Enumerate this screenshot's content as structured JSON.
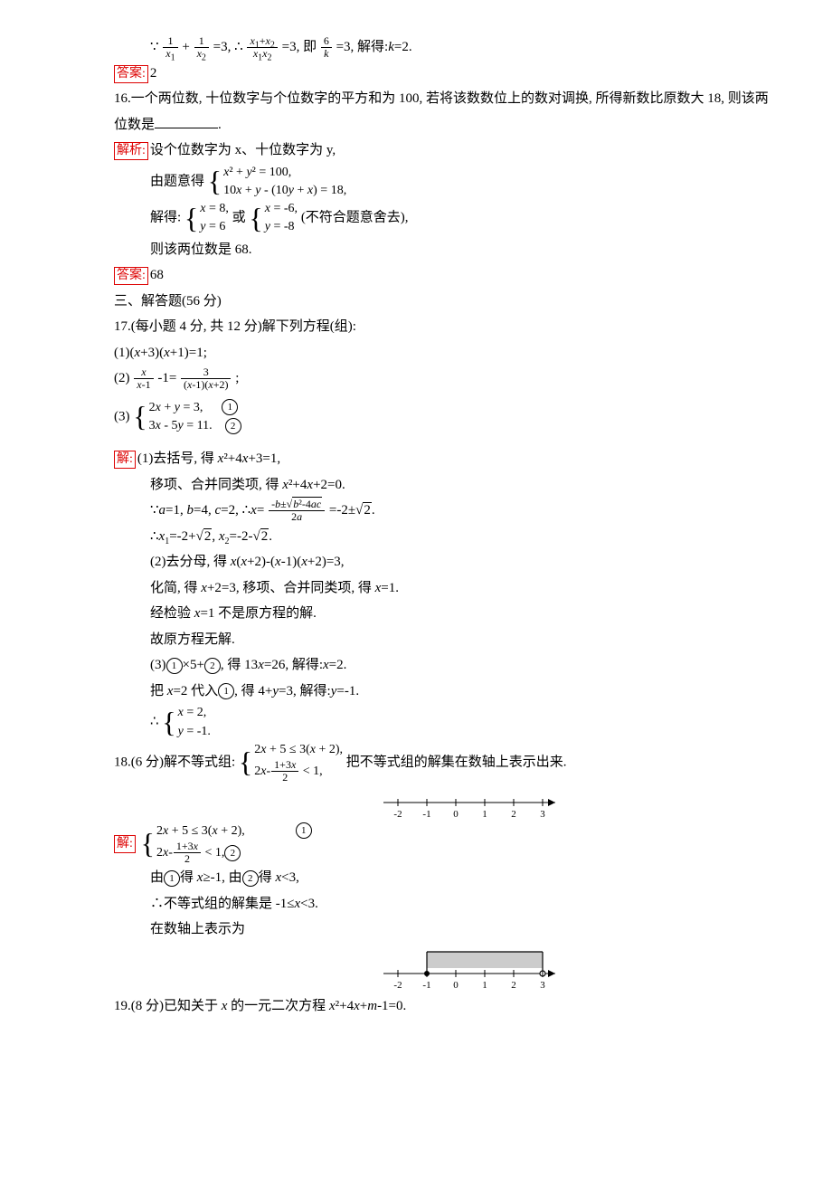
{
  "q15": {
    "work_line": "∵ 1/x₁ + 1/x₂ = 3, ∴ (x₁+x₂)/(x₁x₂) = 3, 即 6/k = 3, 解得: k=2.",
    "answer_label": "答案:",
    "answer_value": "2"
  },
  "q16": {
    "number": "16.",
    "stem": "一个两位数, 十位数字与个位数字的平方和为 100, 若将该数数位上的数对调换, 所得新数比原数大 18, 则该两位数是",
    "blank": "__________.",
    "analysis_label": "解析:",
    "analysis_intro": "设个位数字为 x、十位数字为 y,",
    "equations_intro": "由题意得",
    "eq1": "x² + y² = 100,",
    "eq2": "10x + y - (10y + x) = 18,",
    "solve_intro": "解得:",
    "sol1a": "x = 8,",
    "sol1b": "y = 6",
    "or_text": "或",
    "sol2a": "x = -6,",
    "sol2b": "y = -8",
    "reject": "(不符合题意舍去),",
    "conclusion": "则该两位数是 68.",
    "answer_label": "答案:",
    "answer_value": "68"
  },
  "section3": "三、解答题(56 分)",
  "q17": {
    "number": "17.",
    "stem": "(每小题 4 分, 共 12 分)解下列方程(组):",
    "p1": "(1)(x+3)(x+1)=1;",
    "p2_left": "(2)",
    "p2_frac1_num": "x",
    "p2_frac1_den": "x-1",
    "p2_mid": "-1=",
    "p2_frac2_num": "3",
    "p2_frac2_den": "(x-1)(x+2)",
    "p2_end": ";",
    "p3_left": "(3)",
    "p3_eq1": "2x + y = 3,",
    "p3_eq2": "3x - 5y = 11.",
    "circ1": "①",
    "circ2": "②",
    "sol_label": "解:",
    "s1a": "(1)去括号, 得 x²+4x+3=1,",
    "s1b": "移项、合并同类项, 得 x²+4x+2=0.",
    "s1c_pre": "∵a=1, b=4, c=2, ∴x=",
    "s1c_num": "-b±√(b²-4ac)",
    "s1c_den": "2a",
    "s1c_post": "=-2±√2.",
    "s1d": "∴x₁=-2+√2, x₂=-2-√2.",
    "s2a": "(2)去分母, 得 x(x+2)-(x-1)(x+2)=3,",
    "s2b": "化简, 得 x+2=3, 移项、合并同类项, 得 x=1.",
    "s2c": "经检验 x=1 不是原方程的解.",
    "s2d": "故原方程无解.",
    "s3a": "(3)①×5+②, 得 13x=26, 解得: x=2.",
    "s3b": "把 x=2 代入①, 得 4+y=3, 解得: y=-1.",
    "s3c_pre": "∴",
    "s3c1": "x = 2,",
    "s3c2": "y = -1."
  },
  "q18": {
    "number": "18.",
    "stem_pre": "(6 分)解不等式组:",
    "ineq1": "2x + 5 ≤ 3(x + 2),",
    "ineq2_left": "2x-",
    "ineq2_frac_num": "1+3x",
    "ineq2_frac_den": "2",
    "ineq2_right": "< 1,",
    "stem_post": "把不等式组的解集在数轴上表示出来.",
    "numberline_ticks": [
      -2,
      -1,
      0,
      1,
      2,
      3
    ],
    "sol_label": "解:",
    "sys_circ1": "①",
    "sys_circ2": "②",
    "s1": "由①得 x≥-1, 由②得 x<3,",
    "s2": "∴不等式组的解集是 -1≤x<3.",
    "s3": "在数轴上表示为",
    "solution_interval": {
      "start": -1,
      "start_closed": true,
      "end": 3,
      "end_closed": false
    }
  },
  "q19": {
    "number": "19.",
    "stem": "(8 分)已知关于 x 的一元二次方程 x²+4x+m-1=0."
  }
}
